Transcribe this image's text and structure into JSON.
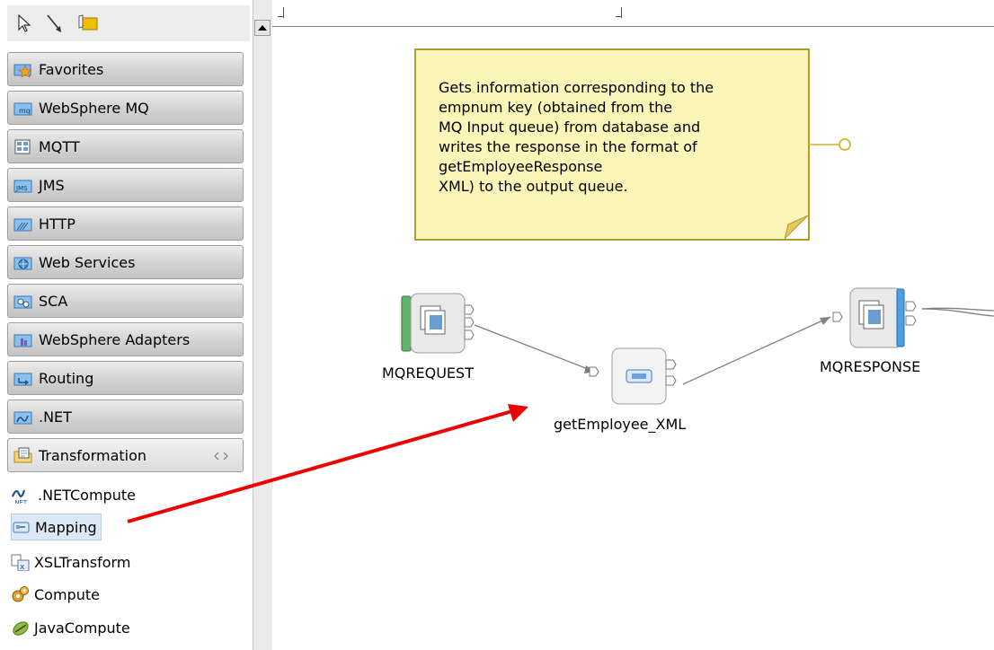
{
  "palette": {
    "drawers": [
      {
        "label": "Favorites",
        "icon": "favorites-star-icon"
      },
      {
        "label": "WebSphere MQ",
        "icon": "mq-folder-icon"
      },
      {
        "label": "MQTT",
        "icon": "mqtt-folder-icon"
      },
      {
        "label": "JMS",
        "icon": "jms-folder-icon"
      },
      {
        "label": "HTTP",
        "icon": "http-folder-icon"
      },
      {
        "label": "Web Services",
        "icon": "web-services-folder-icon"
      },
      {
        "label": "SCA",
        "icon": "sca-folder-icon"
      },
      {
        "label": "WebSphere Adapters",
        "icon": "adapters-folder-icon"
      },
      {
        "label": "Routing",
        "icon": "routing-folder-icon"
      },
      {
        "label": ".NET",
        "icon": "dotnet-folder-icon"
      },
      {
        "label": "Transformation",
        "icon": "transformation-folder-icon"
      }
    ],
    "transformation_items": [
      {
        "label": ".NETCompute",
        "icon": "dotnet-compute-icon",
        "selected": false
      },
      {
        "label": "Mapping",
        "icon": "mapping-icon",
        "selected": true
      },
      {
        "label": "XSLTransform",
        "icon": "xsl-transform-icon",
        "selected": false
      },
      {
        "label": "Compute",
        "icon": "compute-gears-icon",
        "selected": false
      },
      {
        "label": "JavaCompute",
        "icon": "java-compute-icon",
        "selected": false
      }
    ],
    "tools": [
      "selection-arrow-icon",
      "connection-icon",
      "note-pin-icon"
    ]
  },
  "canvas": {
    "note_text": "Gets information corresponding to the\nempnum key (obtained from the\nMQ Input queue) from database and\nwrites the response in the format of\ngetEmployeeResponse\nXML) to the output queue.",
    "nodes": {
      "input": "MQREQUEST",
      "mapping": "getEmployee_XML",
      "output": "MQRESPONSE"
    }
  },
  "colors": {
    "annotation_arrow": "#ee0000",
    "note_fill": "#fbf5b8",
    "note_border": "#b59a2e"
  }
}
